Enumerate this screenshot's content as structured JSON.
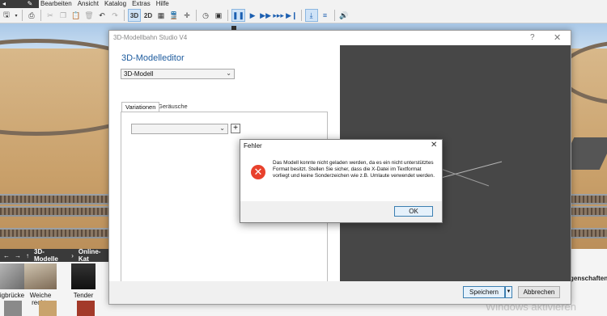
{
  "menubar": {
    "items": [
      "Bearbeiten",
      "Ansicht",
      "Katalog",
      "Extras",
      "Hilfe"
    ]
  },
  "toolbar": {
    "view_3d": "3D",
    "view_2d": "2D"
  },
  "dialog": {
    "title": "3D-Modellbahn Studio V4",
    "help": "?",
    "close": "✕",
    "heading": "3D-Modelleditor",
    "model_select": "3D-Modell",
    "tabs": [
      "Variationen",
      "Geräusche"
    ],
    "variation_select": "",
    "add_button": "+",
    "save_button": "Speichern",
    "cancel_button": "Abbrechen"
  },
  "error_dialog": {
    "title": "Fehler",
    "close": "✕",
    "message": "Das Modell konnte nicht geladen werden, da es ein nicht unterstütztes Format besitzt. Stellen Sie sicher, dass die X-Datei im Textformat vorliegt und keine Sonderzeichen wie z.B. Umlaute verwendet werden.",
    "ok_button": "OK"
  },
  "catalog": {
    "path": [
      "3D-Modelle",
      "Online-Kat"
    ],
    "items": [
      "igbrücke",
      "Weiche rechts",
      "Tender"
    ]
  },
  "right_panel": {
    "label": "genschaften z"
  },
  "watermark": "Windows aktivieren",
  "colors": {
    "accent": "#1d5b9e",
    "error": "#e8412c",
    "preview_bg": "#474747"
  }
}
